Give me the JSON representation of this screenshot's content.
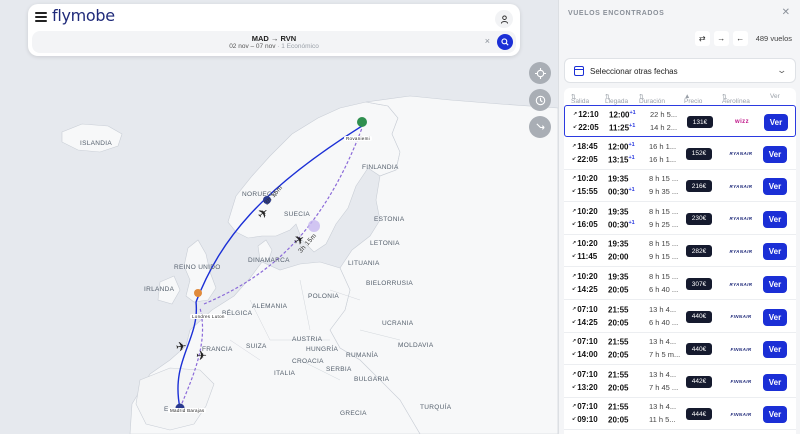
{
  "app": {
    "logo": "flymobe"
  },
  "search": {
    "route": "MAD → RVN",
    "dates": "02 nov – 07 nov",
    "passengers": "· 1 Económico",
    "clear": "×"
  },
  "map": {
    "labels": {
      "islandia": "ISLANDIA",
      "noruega": "NORUEGA",
      "suecia": "SUECIA",
      "finlandia": "FINLANDIA",
      "reino_unido": "REINO UNIDO",
      "irlanda": "IRLANDA",
      "dinamarca": "DINAMARCA",
      "estonia": "ESTONIA",
      "letonia": "LETONIA",
      "lituania": "LITUANIA",
      "bielorrusia": "BIELORRUSIA",
      "polonia": "POLONIA",
      "alemania": "ALEMANIA",
      "belgica": "BÉLGICA",
      "ucrania": "UCRANIA",
      "francia": "FRANCIA",
      "suiza": "SUIZA",
      "austria": "AUSTRIA",
      "hungria": "HUNGRÍA",
      "rumania": "RUMANÍA",
      "moldavia": "MOLDAVIA",
      "italia": "ITALIA",
      "croacia": "CROACIA",
      "serbia": "SERBIA",
      "bulgaria": "BULGARIA",
      "grecia": "GRECIA",
      "turquia": "TURQUÍA",
      "espana": "E"
    },
    "leg_labels": {
      "leg1": "3h 15m",
      "leg2": "3h 15m"
    },
    "airports": {
      "rovaniemi": "Rovaniemi",
      "london": "Londres Luton",
      "madrid": "Madrid Barajas"
    },
    "colors": {
      "route_primary": "#1b2fd6",
      "route_secondary": "#8b6ad9"
    }
  },
  "panel": {
    "title": "VUELOS ENCONTRADOS",
    "count": "489 vuelos",
    "date_select": "Seleccionar otras fechas",
    "columns": {
      "salida": "Salida",
      "llegada": "Llegada",
      "duracion": "Duración",
      "precio": "Precio",
      "aerolinea": "Aerolínea",
      "ver": "Ver"
    },
    "flights": [
      {
        "out_dep": "12:10",
        "out_arr": "12:00",
        "out_plus": "+1",
        "out_dur": "22 h 5...",
        "in_dep": "22:05",
        "in_arr": "11:25",
        "in_plus": "+1",
        "in_dur": "14 h 2...",
        "price": "131€",
        "airline": "wizz",
        "button": "Ver",
        "selected": true
      },
      {
        "out_dep": "18:45",
        "out_arr": "12:00",
        "out_plus": "+1",
        "out_dur": "16 h 1...",
        "in_dep": "22:05",
        "in_arr": "13:15",
        "in_plus": "+1",
        "in_dur": "16 h 1...",
        "price": "152€",
        "airline": "RYANAIR",
        "button": "Ver"
      },
      {
        "out_dep": "10:20",
        "out_arr": "19:35",
        "out_plus": "",
        "out_dur": "8 h 15 ...",
        "in_dep": "15:55",
        "in_arr": "00:30",
        "in_plus": "+1",
        "in_dur": "9 h 35 ...",
        "price": "216€",
        "airline": "RYANAIR",
        "button": "Ver"
      },
      {
        "out_dep": "10:20",
        "out_arr": "19:35",
        "out_plus": "",
        "out_dur": "8 h 15 ...",
        "in_dep": "16:05",
        "in_arr": "00:30",
        "in_plus": "+1",
        "in_dur": "9 h 25 ...",
        "price": "230€",
        "airline": "RYANAIR",
        "button": "Ver"
      },
      {
        "out_dep": "10:20",
        "out_arr": "19:35",
        "out_plus": "",
        "out_dur": "8 h 15 ...",
        "in_dep": "11:45",
        "in_arr": "20:00",
        "in_plus": "",
        "in_dur": "9 h 15 ...",
        "price": "282€",
        "airline": "RYANAIR",
        "button": "Ver"
      },
      {
        "out_dep": "10:20",
        "out_arr": "19:35",
        "out_plus": "",
        "out_dur": "8 h 15 ...",
        "in_dep": "14:25",
        "in_arr": "20:05",
        "in_plus": "",
        "in_dur": "6 h 40 ...",
        "price": "307€",
        "airline": "RYANAIR",
        "button": "Ver"
      },
      {
        "out_dep": "07:10",
        "out_arr": "21:55",
        "out_plus": "",
        "out_dur": "13 h 4...",
        "in_dep": "14:25",
        "in_arr": "20:05",
        "in_plus": "",
        "in_dur": "6 h 40 ...",
        "price": "440€",
        "airline": "FINNAIR",
        "button": "Ver"
      },
      {
        "out_dep": "07:10",
        "out_arr": "21:55",
        "out_plus": "",
        "out_dur": "13 h 4...",
        "in_dep": "14:00",
        "in_arr": "20:05",
        "in_plus": "",
        "in_dur": "7 h 5 m...",
        "price": "440€",
        "airline": "FINNAIR",
        "button": "Ver"
      },
      {
        "out_dep": "07:10",
        "out_arr": "21:55",
        "out_plus": "",
        "out_dur": "13 h 4...",
        "in_dep": "13:20",
        "in_arr": "20:05",
        "in_plus": "",
        "in_dur": "7 h 45 ...",
        "price": "442€",
        "airline": "FINNAIR",
        "button": "Ver"
      },
      {
        "out_dep": "07:10",
        "out_arr": "21:55",
        "out_plus": "",
        "out_dur": "13 h 4...",
        "in_dep": "09:10",
        "in_arr": "20:05",
        "in_plus": "",
        "in_dur": "11 h 5...",
        "price": "444€",
        "airline": "FINNAIR",
        "button": "Ver"
      }
    ]
  }
}
